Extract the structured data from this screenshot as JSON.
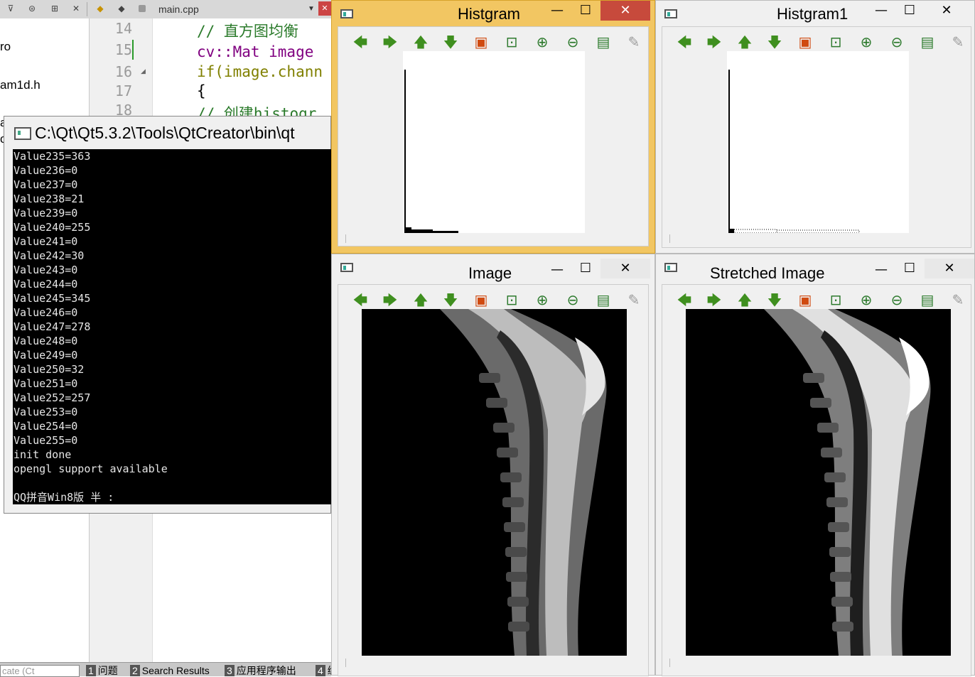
{
  "qt_creator": {
    "file_combo": "main.cpp",
    "sidebar_items": [
      "ro",
      "am1d.h",
      "a",
      "o"
    ],
    "line_numbers": [
      "14",
      "15",
      "16",
      "17",
      "18"
    ],
    "code_lines": [
      {
        "text": "// 直方图均衡",
        "color": "#2a7a2a"
      },
      {
        "text": "cv::Mat image",
        "color": "#800080"
      },
      {
        "text": "if(image.chann",
        "color": "#808000"
      },
      {
        "text": "{",
        "color": "#000000"
      },
      {
        "text": "// 创建histogr",
        "color": "#2a7a2a"
      }
    ],
    "status_locate_placeholder": "cate (Ct",
    "output_tabs": [
      {
        "num": "1",
        "label": "问题"
      },
      {
        "num": "2",
        "label": "Search Results"
      },
      {
        "num": "3",
        "label": "应用程序输出"
      },
      {
        "num": "4",
        "label": "编"
      }
    ]
  },
  "console": {
    "title": "C:\\Qt\\Qt5.3.2\\Tools\\QtCreator\\bin\\qt",
    "lines": [
      "Value235=363",
      "Value236=0",
      "Value237=0",
      "Value238=21",
      "Value239=0",
      "Value240=255",
      "Value241=0",
      "Value242=30",
      "Value243=0",
      "Value244=0",
      "Value245=345",
      "Value246=0",
      "Value247=278",
      "Value248=0",
      "Value249=0",
      "Value250=32",
      "Value251=0",
      "Value252=257",
      "Value253=0",
      "Value254=0",
      "Value255=0",
      "init done",
      "opengl support available",
      "",
      "QQ拼音Win8版 半 :"
    ]
  },
  "window_controls": {
    "minimize": "—",
    "maximize": "☐",
    "close": "✕"
  },
  "toolbar_icons": [
    {
      "name": "pan-left-icon",
      "glyph": "🡄",
      "kind": "arrow"
    },
    {
      "name": "pan-right-icon",
      "glyph": "🡆",
      "kind": "arrow"
    },
    {
      "name": "pan-up-icon",
      "glyph": "🡅",
      "kind": "arrow"
    },
    {
      "name": "pan-down-icon",
      "glyph": "🡇",
      "kind": "arrow"
    },
    {
      "name": "zoom-original-icon",
      "glyph": "▣",
      "kind": "img"
    },
    {
      "name": "zoom-fit-icon",
      "glyph": "⊡",
      "kind": "zoom"
    },
    {
      "name": "zoom-in-icon",
      "glyph": "⊕",
      "kind": "zoom"
    },
    {
      "name": "zoom-out-icon",
      "glyph": "⊖",
      "kind": "zoom"
    },
    {
      "name": "save-icon",
      "glyph": "▤",
      "kind": "save"
    },
    {
      "name": "properties-icon",
      "glyph": "✎",
      "kind": "prop"
    }
  ],
  "windows": {
    "histgram": {
      "title": "Histgram"
    },
    "histgram1": {
      "title": "Histgram1"
    },
    "image": {
      "title": "Image"
    },
    "stretched": {
      "title": "Stretched Image"
    }
  }
}
